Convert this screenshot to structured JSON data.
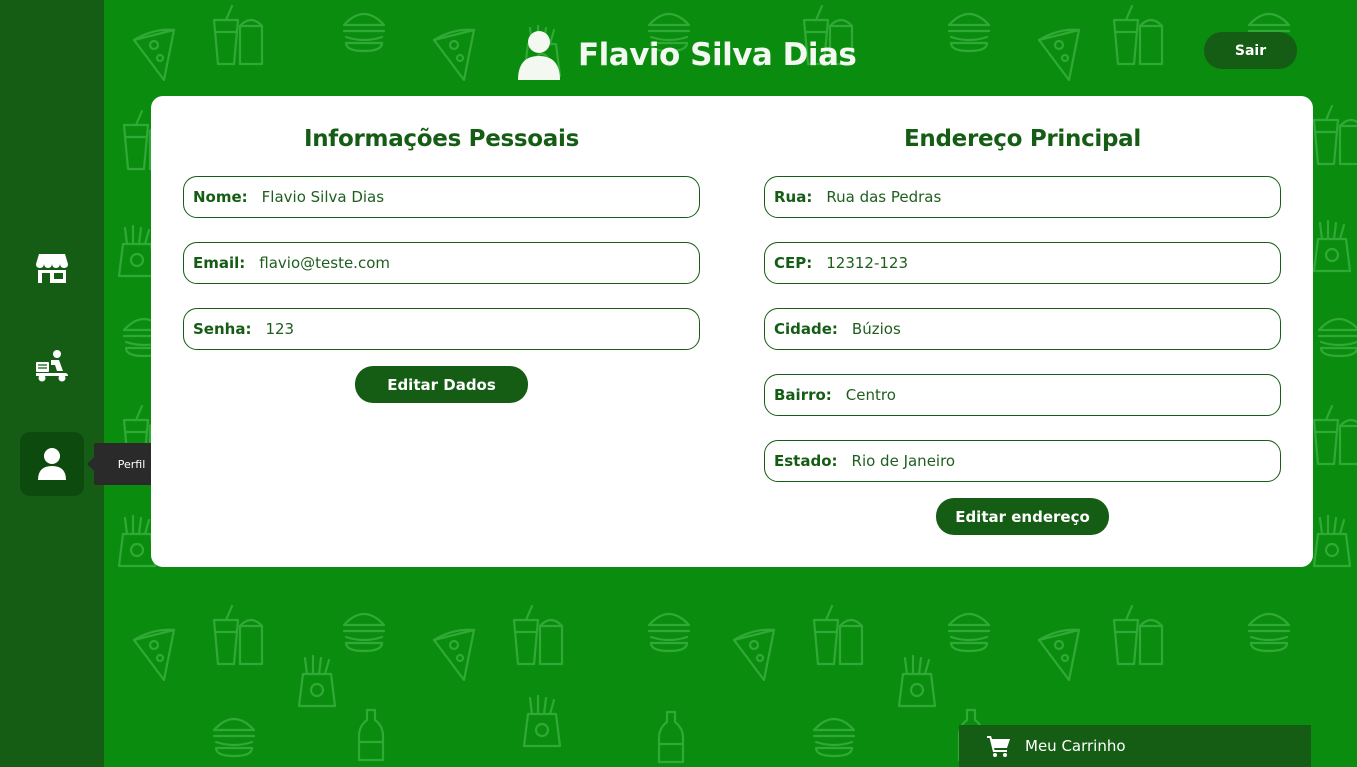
{
  "colors": {
    "background": "#0a8c0f",
    "sidebar": "#155d14",
    "accent": "#155d14",
    "card": "#ffffff"
  },
  "sidebar": {
    "items": [
      {
        "icon": "store-icon"
      },
      {
        "icon": "delivery-icon"
      },
      {
        "icon": "user-icon",
        "active": true,
        "tooltip": "Perfil"
      }
    ]
  },
  "header": {
    "user_name": "Flavio Silva Dias",
    "logout_label": "Sair"
  },
  "personal": {
    "title": "Informações Pessoais",
    "fields": [
      {
        "label": "Nome:",
        "value": "Flavio Silva Dias"
      },
      {
        "label": "Email:",
        "value": "flavio@teste.com"
      },
      {
        "label": "Senha:",
        "value": "123"
      }
    ],
    "button": "Editar Dados"
  },
  "address": {
    "title": "Endereço Principal",
    "fields": [
      {
        "label": "Rua:",
        "value": "Rua das Pedras"
      },
      {
        "label": "CEP:",
        "value": "12312-123"
      },
      {
        "label": "Cidade:",
        "value": "Búzios"
      },
      {
        "label": "Bairro:",
        "value": "Centro"
      },
      {
        "label": "Estado:",
        "value": "Rio de Janeiro"
      }
    ],
    "button": "Editar endereço"
  },
  "cart": {
    "label": "Meu Carrinho"
  }
}
